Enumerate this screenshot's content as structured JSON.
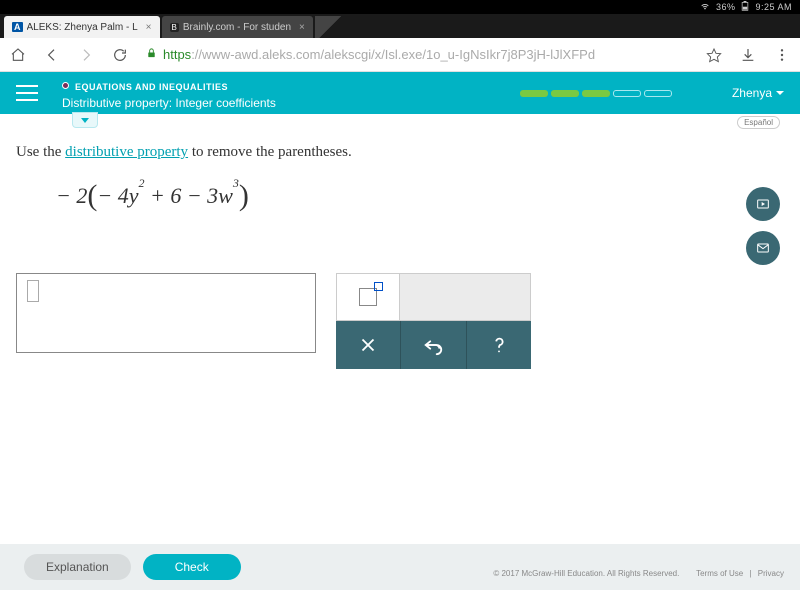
{
  "status": {
    "wifi": "wifi-icon",
    "battery": "36%",
    "time": "9:25 AM"
  },
  "tabs": [
    {
      "title": "ALEKS: Zhenya Palm - L",
      "favicon": "A",
      "active": true
    },
    {
      "title": "Brainly.com - For studen",
      "favicon": "B",
      "active": false
    }
  ],
  "url": {
    "secure": "https",
    "host": "://www-awd.aleks.com",
    "path": "/alekscgi/x/Isl.exe/1o_u-IgNsIkr7j8P3jH-lJlXFPd"
  },
  "header": {
    "topic_path": "EQUATIONS AND INEQUALITIES",
    "topic_title": "Distributive property: Integer coefficients",
    "user": "Zhenya"
  },
  "lang_pill": "Español",
  "prompt": {
    "pre": "Use the ",
    "link": "distributive property",
    "post": " to remove the parentheses."
  },
  "expression": {
    "lead": "− 2",
    "lp": "(",
    "t1": "− 4",
    "v1": "y",
    "e1": "2",
    "plus": " + 6 − 3",
    "v2": "w",
    "e2": "3",
    "rp": ")"
  },
  "buttons": {
    "explanation": "Explanation",
    "check": "Check"
  },
  "footer": {
    "copyright": "© 2017 McGraw-Hill Education. All Rights Reserved.",
    "terms": "Terms of Use",
    "privacy": "Privacy"
  }
}
